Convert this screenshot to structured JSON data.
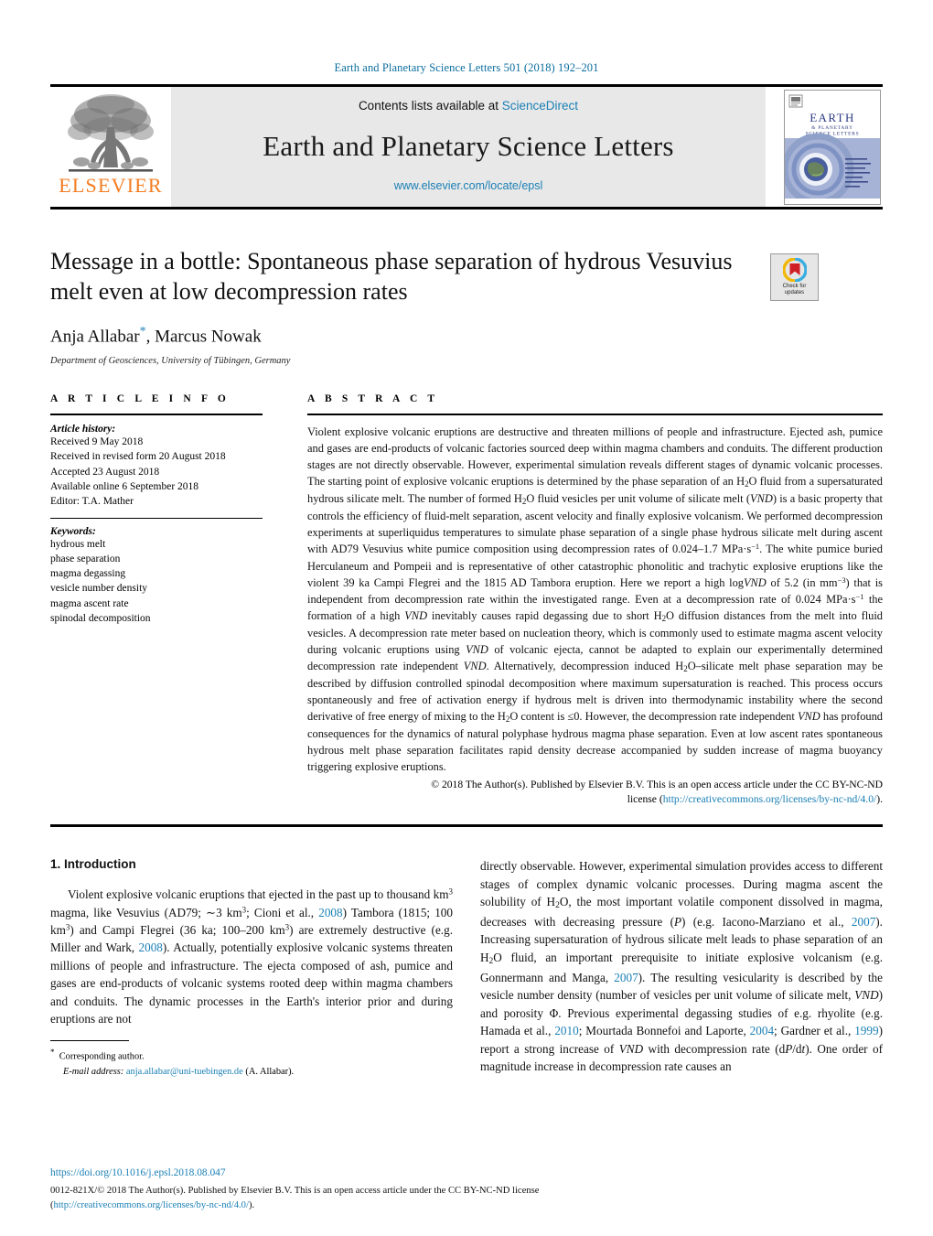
{
  "running_head": "Earth and Planetary Science Letters 501 (2018) 192–201",
  "masthead": {
    "publisher_name": "ELSEVIER",
    "contents_prefix": "Contents lists available at ",
    "contents_link": "ScienceDirect",
    "journal_title": "Earth and Planetary Science Letters",
    "journal_url": "www.elsevier.com/locate/epsl",
    "cover_title_line1": "EARTH",
    "cover_title_line2": "& PLANETARY",
    "cover_title_line3": "SCIENCE LETTERS"
  },
  "article": {
    "title": "Message in a bottle: Spontaneous phase separation of hydrous Vesuvius melt even at low decompression rates",
    "authors": "Anja Allabar",
    "authors_rest": ", Marcus Nowak",
    "corresponding_marker": "*",
    "affiliation": "Department of Geosciences, University of Tübingen, Germany",
    "crossmark_label_line1": "Check for",
    "crossmark_label_line2": "updates"
  },
  "article_info": {
    "heading": "A R T I C L E    I N F O",
    "history_label": "Article history:",
    "history": [
      "Received 9 May 2018",
      "Received in revised form 20 August 2018",
      "Accepted 23 August 2018",
      "Available online 6 September 2018",
      "Editor: T.A. Mather"
    ],
    "keywords_label": "Keywords:",
    "keywords": [
      "hydrous melt",
      "phase separation",
      "magma degassing",
      "vesicle number density",
      "magma ascent rate",
      "spinodal decomposition"
    ]
  },
  "abstract": {
    "heading": "A B S T R A C T",
    "paragraph_html": "Violent explosive volcanic eruptions are destructive and threaten millions of people and infrastructure. Ejected ash, pumice and gases are end-products of volcanic factories sourced deep within magma chambers and conduits. The different production stages are not directly observable. However, experimental simulation reveals different stages of dynamic volcanic processes. The starting point of explosive volcanic eruptions is determined by the phase separation of an H<sub>2</sub>O fluid from a supersaturated hydrous silicate melt. The number of formed H<sub>2</sub>O fluid vesicles per unit volume of silicate melt (<i>VND</i>) is a basic property that controls the efficiency of fluid-melt separation, ascent velocity and finally explosive volcanism. We performed decompression experiments at superliquidus temperatures to simulate phase separation of a single phase hydrous silicate melt during ascent with AD79 Vesuvius white pumice composition using decompression rates of 0.024–1.7 MPa·s<sup>−1</sup>. The white pumice buried Herculaneum and Pompeii and is representative of other catastrophic phonolitic and trachytic explosive eruptions like the violent 39 ka Campi Flegrei and the 1815 AD Tambora eruption. Here we report a high log<i>VND</i> of 5.2 (in mm<sup>−3</sup>) that is independent from decompression rate within the investigated range. Even at a decompression rate of 0.024 MPa·s<sup>−1</sup> the formation of a high <i>VND</i> inevitably causes rapid degassing due to short H<sub>2</sub>O diffusion distances from the melt into fluid vesicles. A decompression rate meter based on nucleation theory, which is commonly used to estimate magma ascent velocity during volcanic eruptions using <i>VND</i> of volcanic ejecta, cannot be adapted to explain our experimentally determined decompression rate independent <i>VND</i>. Alternatively, decompression induced H<sub>2</sub>O–silicate melt phase separation may be described by diffusion controlled spinodal decomposition where maximum supersaturation is reached. This process occurs spontaneously and free of activation energy if hydrous melt is driven into thermodynamic instability where the second derivative of free energy of mixing to the H<sub>2</sub>O content is ≤0. However, the decompression rate independent <i>VND</i> has profound consequences for the dynamics of natural polyphase hydrous magma phase separation. Even at low ascent rates spontaneous hydrous melt phase separation facilitates rapid density decrease accompanied by sudden increase of magma buoyancy triggering explosive eruptions.",
    "copyright_line1": "© 2018 The Author(s). Published by Elsevier B.V. This is an open access article under the CC BY-NC-ND",
    "copyright_line2_prefix": "license (",
    "copyright_link": "http://creativecommons.org/licenses/by-nc-nd/4.0/",
    "copyright_line2_suffix": ")."
  },
  "introduction": {
    "heading": "1. Introduction",
    "left_html": "Violent explosive volcanic eruptions that ejected in the past up to thousand km<sup>3</sup> magma, like Vesuvius (AD79; ∼3 km<sup>3</sup>; Cioni et al., <span class=\"lnk\">2008</span>) Tambora (1815; 100 km<sup>3</sup>) and Campi Flegrei (36 ka; 100–200 km<sup>3</sup>) are extremely destructive (e.g. Miller and Wark, <span class=\"lnk\">2008</span>). Actually, potentially explosive volcanic systems threaten millions of people and infrastructure. The ejecta composed of ash, pumice and gases are end-products of volcanic systems rooted deep within magma chambers and conduits. The dynamic processes in the Earth's interior prior and during eruptions are not",
    "right_html": "directly observable. However, experimental simulation provides access to different stages of complex dynamic volcanic processes. During magma ascent the solubility of H<sub>2</sub>O, the most important volatile component dissolved in magma, decreases with decreasing pressure (<i>P</i>) (e.g. Iacono-Marziano et al., <span class=\"lnk\">2007</span>). Increasing supersaturation of hydrous silicate melt leads to phase separation of an H<sub>2</sub>O fluid, an important prerequisite to initiate explosive volcanism (e.g. Gonnermann and Manga, <span class=\"lnk\">2007</span>). The resulting vesicularity is described by the vesicle number density (number of vesicles per unit volume of silicate melt, <i>VND</i>) and porosity Φ. Previous experimental degassing studies of e.g. rhyolite (e.g. Hamada et al., <span class=\"lnk\">2010</span>; Mourtada Bonnefoi and Laporte, <span class=\"lnk\">2004</span>; Gardner et al., <span class=\"lnk\">1999</span>) report a strong increase of <i>VND</i> with decompression rate (d<i>P</i>/d<i>t</i>). One order of magnitude increase in decompression rate causes an"
  },
  "footnote": {
    "corresponding_author": "Corresponding author.",
    "email_label": "E-mail address:",
    "email": "anja.allabar@uni-tuebingen.de",
    "email_owner": "(A. Allabar)."
  },
  "footer": {
    "doi": "https://doi.org/10.1016/j.epsl.2018.08.047",
    "issn_line_html": "0012-821X/© 2018 The Author(s). Published by Elsevier B.V. This is an open access article under the CC BY-NC-ND license",
    "issn_link": "http://creativecommons.org/licenses/by-nc-nd/4.0/"
  },
  "colors": {
    "link_blue": "#1a7fb5",
    "elsevier_orange": "#f47c20",
    "masthead_gray": "#e8e8e8"
  }
}
